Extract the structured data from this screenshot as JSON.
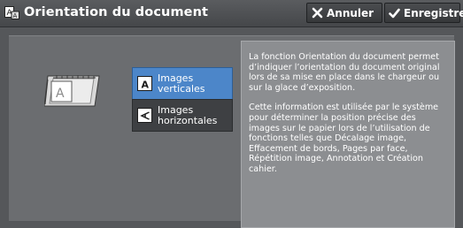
{
  "header": {
    "title": "Orientation du document",
    "title_icon": "document-orientation-icon",
    "cancel_label": "Annuler",
    "save_label": "Enregistrer"
  },
  "options": [
    {
      "label": "Images verticales",
      "icon": "letter-a-upright-icon",
      "selected": true
    },
    {
      "label": "Images horizontales",
      "icon": "letter-a-rotated-icon",
      "selected": false
    }
  ],
  "info": {
    "paragraph1": "La fonction Orientation du document permet d’indiquer l’orientation du document original lors de sa mise en place dans le chargeur ou sur la glace d’exposition.",
    "paragraph2": "Cette information est utilisée par le système pour déterminer la position précise des images sur le papier lors de l’utilisation de fonctions telles que Décalage image, Effacement de bords, Pages par face, Répétition image, Annotation et Création cahier."
  },
  "colors": {
    "header_bg": "#45474a",
    "panel_bg": "#6b6d70",
    "selected_option": "#4c86c9",
    "unselected_option": "#3e4043",
    "info_bg": "#8c8e91"
  }
}
